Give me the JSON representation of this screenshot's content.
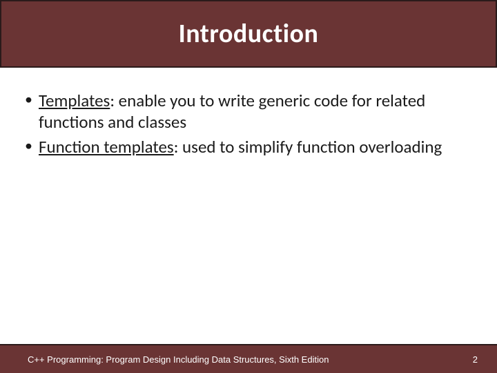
{
  "title": "Introduction",
  "bullets": [
    {
      "term": "Templates",
      "rest": ": enable you to write generic code for related functions and classes"
    },
    {
      "term": "Function templates",
      "rest": ": used to simplify function overloading"
    }
  ],
  "footer": {
    "text": "C++ Programming: Program Design Including Data Structures, Sixth Edition",
    "page": "2"
  }
}
